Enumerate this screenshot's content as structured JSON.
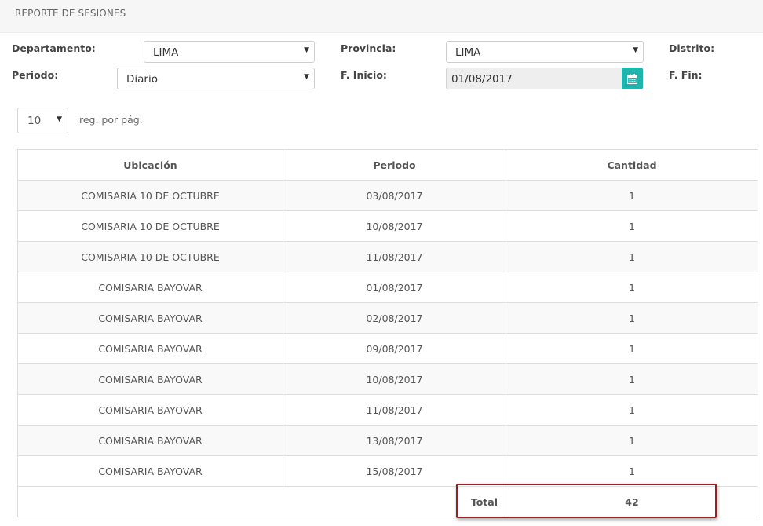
{
  "header": {
    "title": "REPORTE DE SESIONES"
  },
  "filters": {
    "departamento_label": "Departamento:",
    "departamento_value": "LIMA",
    "provincia_label": "Provincia:",
    "provincia_value": "LIMA",
    "distrito_label": "Distrito:",
    "periodo_label": "Periodo:",
    "periodo_value": "Diario",
    "f_inicio_label": "F. Inicio:",
    "f_inicio_value": "01/08/2017",
    "f_fin_label": "F. Fin:",
    "calendar_icon": "calendar-icon"
  },
  "pagination": {
    "per_page_value": "10",
    "per_page_text": "reg. por pág."
  },
  "table": {
    "columns": [
      "Ubicación",
      "Periodo",
      "Cantidad"
    ],
    "rows": [
      {
        "ubicacion": "COMISARIA 10 DE OCTUBRE",
        "periodo": "03/08/2017",
        "cantidad": "1"
      },
      {
        "ubicacion": "COMISARIA 10 DE OCTUBRE",
        "periodo": "10/08/2017",
        "cantidad": "1"
      },
      {
        "ubicacion": "COMISARIA 10 DE OCTUBRE",
        "periodo": "11/08/2017",
        "cantidad": "1"
      },
      {
        "ubicacion": "COMISARIA BAYOVAR",
        "periodo": "01/08/2017",
        "cantidad": "1"
      },
      {
        "ubicacion": "COMISARIA BAYOVAR",
        "periodo": "02/08/2017",
        "cantidad": "1"
      },
      {
        "ubicacion": "COMISARIA BAYOVAR",
        "periodo": "09/08/2017",
        "cantidad": "1"
      },
      {
        "ubicacion": "COMISARIA BAYOVAR",
        "periodo": "10/08/2017",
        "cantidad": "1"
      },
      {
        "ubicacion": "COMISARIA BAYOVAR",
        "periodo": "11/08/2017",
        "cantidad": "1"
      },
      {
        "ubicacion": "COMISARIA BAYOVAR",
        "periodo": "13/08/2017",
        "cantidad": "1"
      },
      {
        "ubicacion": "COMISARIA BAYOVAR",
        "periodo": "15/08/2017",
        "cantidad": "1"
      }
    ],
    "total_label": "Total",
    "total_value": "42"
  },
  "colors": {
    "accent": "#1fb5ac",
    "highlight_border": "#a01c25",
    "header_bg": "#f6f6f7",
    "stripe_bg": "#f9f9f9"
  }
}
